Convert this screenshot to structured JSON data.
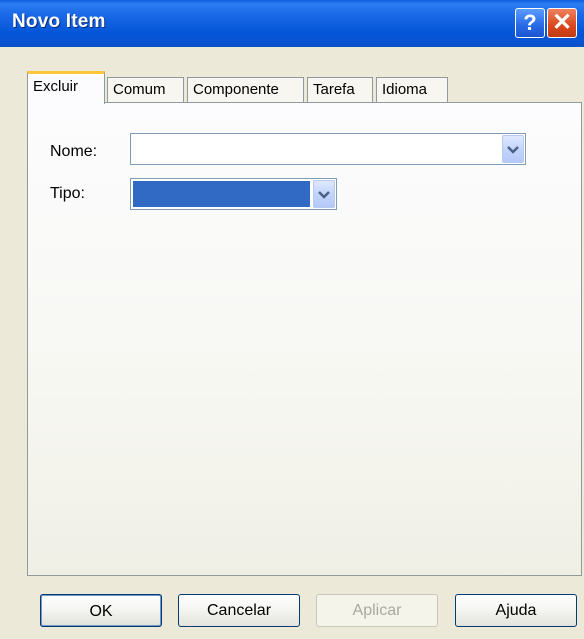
{
  "window": {
    "title": "Novo Item",
    "help_glyph": "?",
    "close_glyph": "✕"
  },
  "tabs": [
    {
      "label": "Excluir",
      "active": true
    },
    {
      "label": "Comum",
      "active": false
    },
    {
      "label": "Componente",
      "active": false
    },
    {
      "label": "Tarefa",
      "active": false
    },
    {
      "label": "Idioma",
      "active": false
    }
  ],
  "form": {
    "nome_label": "Nome:",
    "nome_value": "",
    "tipo_label": "Tipo:",
    "tipo_value": ""
  },
  "buttons": {
    "ok": "OK",
    "cancelar": "Cancelar",
    "aplicar": "Aplicar",
    "ajuda": "Ajuda"
  },
  "colors": {
    "titlebar": "#0555d8",
    "selection": "#316ac5",
    "active_tab_accent": "#ffc83c"
  },
  "icons": {
    "help": "help-icon",
    "close": "close-icon",
    "dropdown": "chevron-down-icon"
  }
}
